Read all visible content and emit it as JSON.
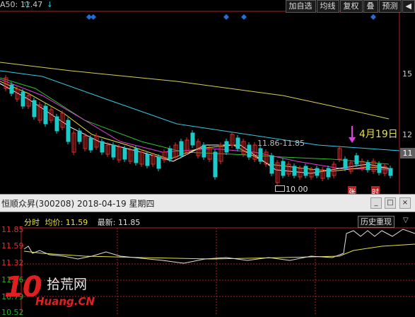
{
  "top": {
    "ma_label": "A50:",
    "ma_value": "11.47",
    "arrow_glyph": "↓"
  },
  "toolbar": [
    "加自选",
    "均线",
    "复权",
    "叠",
    "预测"
  ],
  "toolbar_scroll_glyph": "◀",
  "price_axis_labels": [
    "15",
    "12",
    "11"
  ],
  "annotation": {
    "range_text": "11.86-11.85",
    "date_text": "4月19日",
    "low_text": "10.00"
  },
  "markers": [
    "张",
    "时"
  ],
  "stock_title": "恒顺众昇(300208) 2018-04-19 星期四",
  "window_buttons": [
    "_",
    "□",
    "×"
  ],
  "intraday": {
    "mode_label": "分时",
    "avg_label": "均价:",
    "avg_value": "11.59",
    "last_label": "最新:",
    "last_value": "11.85",
    "replay_label": "历史重现",
    "y_labels": [
      "11.85",
      "11.59",
      "11.32",
      "11.06",
      "10.79",
      "10.52"
    ]
  },
  "logo": {
    "big": "10",
    "cn": "拾荒网",
    "url": "Huang.CN"
  },
  "colors": {
    "rise": "#e03030",
    "fall": "#20c8c8",
    "ma5": "#ffffff",
    "ma10": "#e8e040",
    "ma20": "#e040e0",
    "ma60": "#30c030",
    "ma120": "#38c8e8",
    "ma250": "#d8d050"
  }
}
